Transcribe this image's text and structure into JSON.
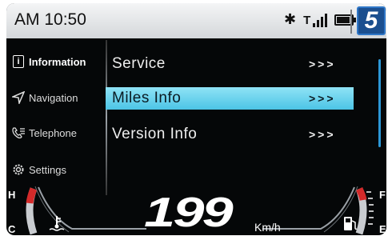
{
  "status": {
    "time": "AM 10:50",
    "bluetooth_icon": "bluetooth-icon",
    "signal_icon": "T signal-bars",
    "signal_label": "T",
    "battery_icon": "battery-icon",
    "logo": "5"
  },
  "sidebar": {
    "items": [
      {
        "label": "Information",
        "icon": "info-icon",
        "active": true
      },
      {
        "label": "Navigation",
        "icon": "navigation-arrow-icon",
        "active": false
      },
      {
        "label": "Telephone",
        "icon": "phone-icon",
        "active": false
      },
      {
        "label": "Settings",
        "icon": "gear-icon",
        "active": false
      }
    ]
  },
  "menu": {
    "items": [
      {
        "label": "Service",
        "arrow": ">>>",
        "selected": false
      },
      {
        "label": "Miles Info",
        "arrow": ">>>",
        "selected": true
      },
      {
        "label": "Version Info",
        "arrow": ">>>",
        "selected": false
      }
    ]
  },
  "gauges": {
    "temp_high": "H",
    "temp_low": "C",
    "fuel_full": "F",
    "fuel_empty": "E",
    "temp_icon": "coolant-temperature-icon",
    "fuel_icon": "fuel-pump-icon"
  },
  "speed": {
    "value": "199",
    "unit": "Km/h"
  },
  "colors": {
    "selected_highlight": "#6fd6ef",
    "accent_blue": "#2c97d6",
    "gauge_red": "#d42a2a"
  }
}
